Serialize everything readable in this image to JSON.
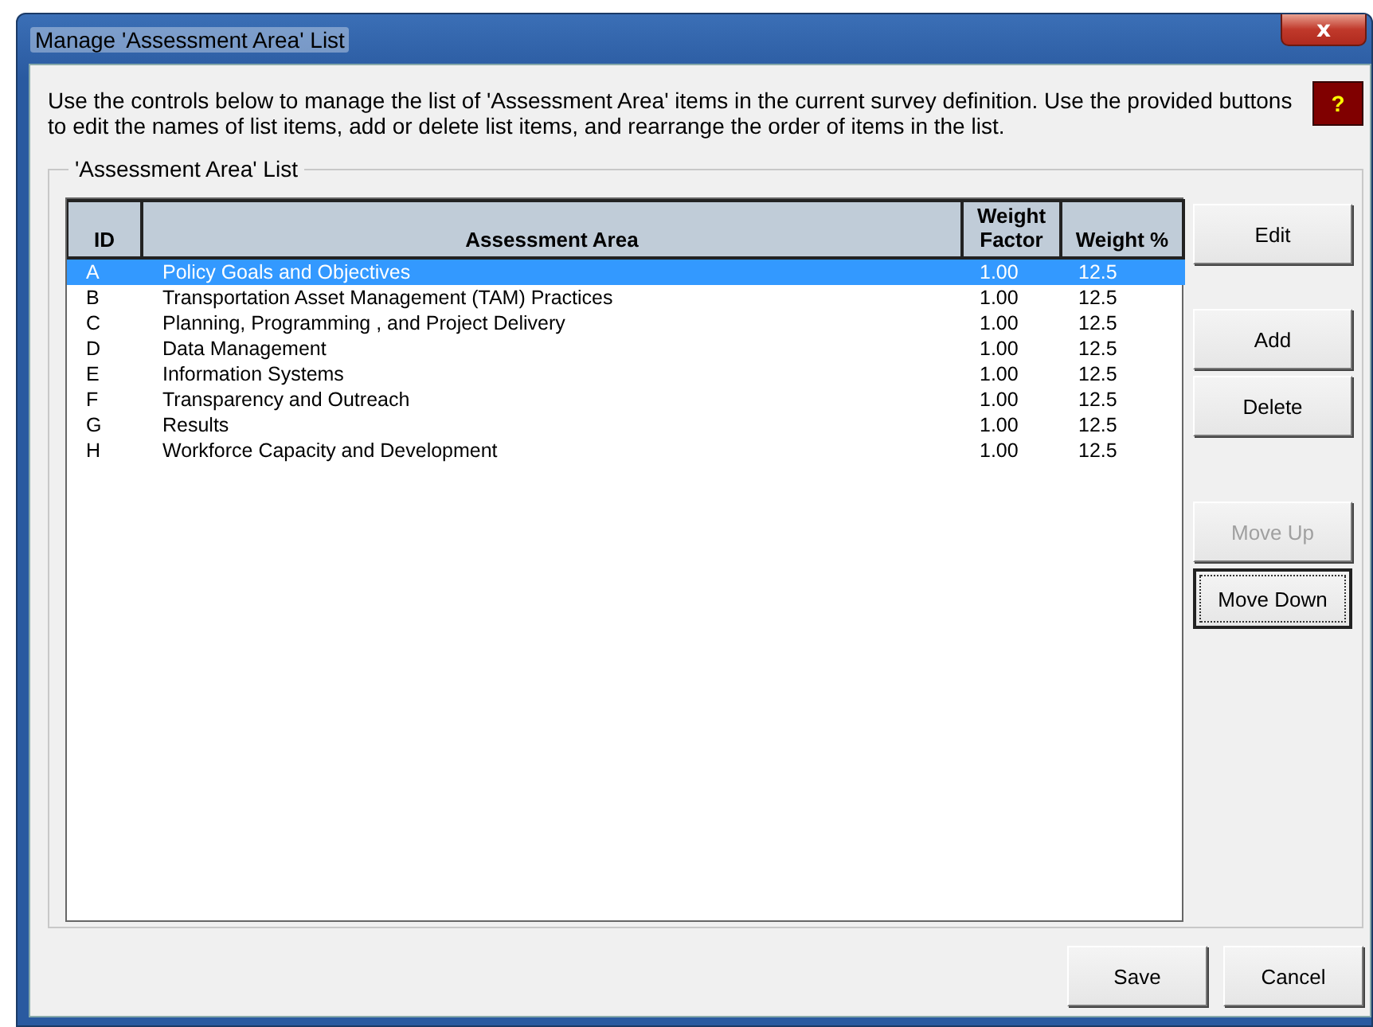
{
  "window": {
    "title": "Manage 'Assessment Area' List",
    "close": "x"
  },
  "help_button": "?",
  "description": "Use the controls below to manage the list of 'Assessment Area'  items in the current survey definition.  Use the provided buttons to edit the names of list items, add or delete list items, and rearrange the order of items in the list.",
  "group": {
    "title": "'Assessment Area' List"
  },
  "table": {
    "columns": [
      "ID",
      "Assessment Area",
      "Weight Factor",
      "Weight %"
    ],
    "rows": [
      {
        "cells": [
          "A",
          "Policy Goals and Objectives",
          "1.00",
          "12.5"
        ],
        "selected": true
      },
      {
        "cells": [
          "B",
          "Transportation Asset Management (TAM) Practices",
          "1.00",
          "12.5"
        ],
        "selected": false
      },
      {
        "cells": [
          "C",
          "Planning, Programming , and Project Delivery",
          "1.00",
          "12.5"
        ],
        "selected": false
      },
      {
        "cells": [
          "D",
          "Data Management",
          "1.00",
          "12.5"
        ],
        "selected": false
      },
      {
        "cells": [
          "E",
          "Information Systems",
          "1.00",
          "12.5"
        ],
        "selected": false
      },
      {
        "cells": [
          "F",
          "Transparency and Outreach",
          "1.00",
          "12.5"
        ],
        "selected": false
      },
      {
        "cells": [
          "G",
          "Results",
          "1.00",
          "12.5"
        ],
        "selected": false
      },
      {
        "cells": [
          "H",
          "Workforce Capacity and Development",
          "1.00",
          "12.5"
        ],
        "selected": false
      }
    ]
  },
  "side_buttons": [
    {
      "label": "Edit",
      "disabled": false,
      "focused": false
    },
    {
      "label": "Add",
      "disabled": false,
      "focused": false
    },
    {
      "label": "Delete",
      "disabled": false,
      "focused": false
    },
    {
      "label": "Move Up",
      "disabled": true,
      "focused": false
    },
    {
      "label": "Move Down",
      "disabled": false,
      "focused": true
    }
  ],
  "footer_buttons": [
    {
      "label": "Save"
    },
    {
      "label": "Cancel"
    }
  ]
}
